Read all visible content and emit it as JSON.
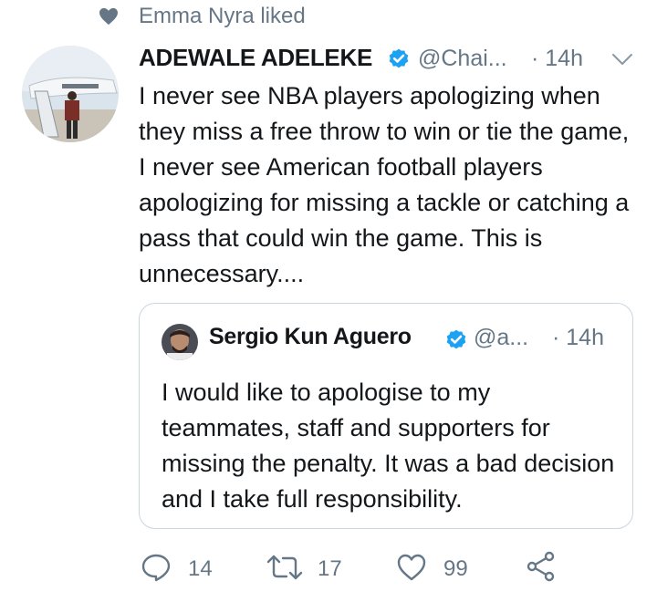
{
  "social_context": {
    "text": "Emma Nyra liked",
    "icon": "heart-icon"
  },
  "tweet": {
    "author_name": "ADEWALE ADELEKE",
    "verified": true,
    "handle": "@Chai...",
    "time": "· 14h",
    "text": "I never see NBA players apologizing when they miss a free throw to win or tie the game, I never see American football players apologizing for missing a tackle or catching a pass that could win the game. This is unnecessary...."
  },
  "quoted_tweet": {
    "author_name": "Sergio Kun Aguero",
    "verified": true,
    "handle": "@a...",
    "time": "· 14h",
    "text": "I would like to apologise to my teammates, staff and supporters for missing the penalty. It was a bad decision and I take full responsibility."
  },
  "actions": {
    "reply_count": "14",
    "retweet_count": "17",
    "like_count": "99"
  },
  "colors": {
    "text": "#14171a",
    "secondary": "#657786",
    "verified": "#1da1f2",
    "border": "#ccd6dd"
  }
}
